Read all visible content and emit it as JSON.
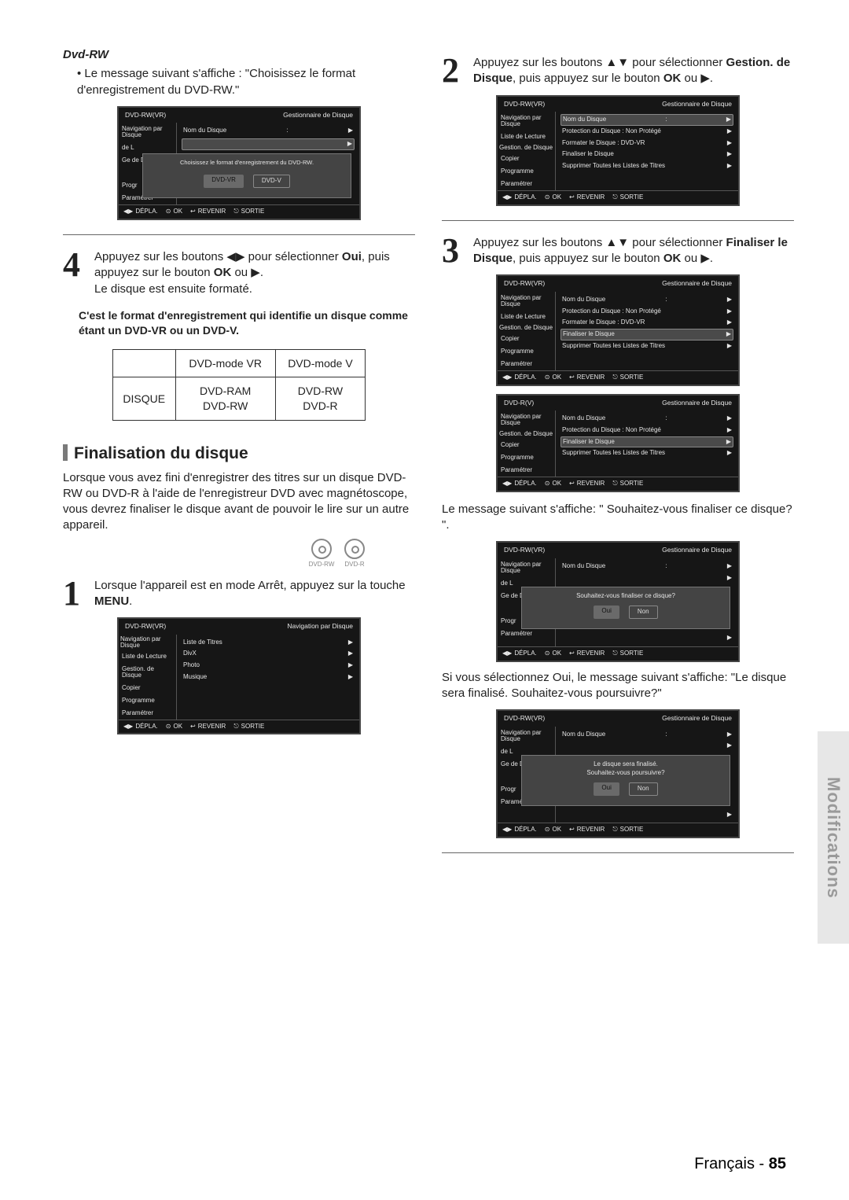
{
  "left": {
    "dvdrw_heading": "Dvd-RW",
    "dvdrw_bullet": "• Le message suivant s'affiche : \"Choisissez le format d'enregistrement du DVD-RW.\"",
    "step4_a": "Appuyez sur les boutons ◀▶ pour sélectionner ",
    "step4_b": "Oui",
    "step4_c": ", puis appuyez sur le bouton ",
    "step4_d": "OK",
    "step4_e": " ou ▶.",
    "step4_f": "Le disque est ensuite formaté.",
    "note": "C'est le format d'enregistrement qui identifie un disque comme étant un DVD-VR ou un DVD-V.",
    "table": {
      "h1": "DVD-mode VR",
      "h2": "DVD-mode V",
      "r1": "DISQUE",
      "c1a": "DVD-RAM",
      "c1b": "DVD-RW",
      "c2a": "DVD-RW",
      "c2b": "DVD-R"
    },
    "final_heading": "Finalisation du disque",
    "final_intro": "Lorsque vous avez fini d'enregistrer des titres sur un disque DVD-RW ou DVD-R à l'aide de l'enregistreur DVD avec magnétoscope, vous devrez finaliser le disque avant de pouvoir le lire sur un autre appareil.",
    "disc1": "DVD-RW",
    "disc2": "DVD-R",
    "step1_a": "Lorsque l'appareil est en mode Arrêt, appuyez sur la touche ",
    "step1_b": "MENU",
    "step1_c": "."
  },
  "right": {
    "step2_a": "Appuyez sur les boutons ▲▼ pour sélectionner ",
    "step2_b": "Gestion. de Disque",
    "step2_c": ", puis appuyez sur le bouton ",
    "step2_d": "OK",
    "step2_e": " ou ▶.",
    "step3_a": "Appuyez sur les boutons ▲▼ pour sélectionner ",
    "step3_b": "Finaliser le Disque",
    "step3_c": ", puis appuyez sur le bouton ",
    "step3_d": "OK",
    "step3_e": " ou ▶.",
    "msg_after": "Le message suivant s'affiche: \" Souhaitez-vous finaliser ce disque? \".",
    "oui_after": "Si vous sélectionnez Oui, le message suivant s'affiche: \"Le disque sera finalisé. Souhaitez-vous poursuivre?\""
  },
  "ui_common": {
    "disc_vr": "DVD-RW(VR)",
    "disc_rv": "DVD-R(V)",
    "gd": "Gestionnaire de Disque",
    "nav_disque": "Navigation par Disque",
    "side": {
      "nav": "Navigation par Disque",
      "liste": "Liste de Lecture",
      "gestion": "Gestion. de Disque",
      "copier": "Copier",
      "prog": "Programme",
      "param": "Paramétrer",
      "de_l": "de L",
      "ge": "Ge de D",
      "progr": "Progr"
    },
    "main": {
      "nom": "Nom du Disque",
      "colon": ":",
      "protection": "Protection du Disque : Non Protégé",
      "formater": "Formater le Disque  : DVD-VR",
      "finaliser": "Finaliser le Disque",
      "supprimer": "Supprimer Toutes les Listes de Titres",
      "liste_titres": "Liste de Titres",
      "divx": "DivX",
      "photo": "Photo",
      "musique": "Musique",
      "choose_fmt": "Choisissez le format d'enregistrement du DVD-RW.",
      "popup_final_q": "Souhaitez-vous  finaliser ce disque?",
      "popup_final_msg1": "Le disque sera  finalisé.",
      "popup_final_msg2": "Souhaitez-vous poursuivre?"
    },
    "btn": {
      "dvdvr": "DVD-VR",
      "dvdv": "DVD-V",
      "oui": "Oui",
      "non": "Non"
    },
    "foot": {
      "depla": "DÉPLA.",
      "ok": "OK",
      "revenir": "REVENIR",
      "sortie": "SORTIE"
    }
  },
  "sidebar_tab": "Modifications",
  "footer": {
    "lang": "Français",
    "dash": " - ",
    "page": "85"
  }
}
